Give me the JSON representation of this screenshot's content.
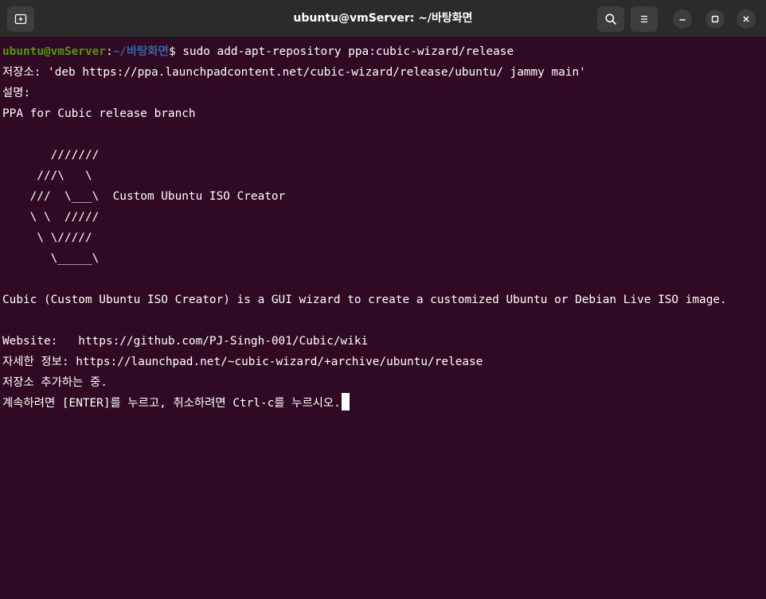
{
  "window": {
    "title": "ubuntu@vmServer: ~/바탕화면"
  },
  "titlebar": {
    "new_tab_icon": "new-tab-icon",
    "search_icon": "search-icon",
    "menu_icon": "hamburger-menu-icon",
    "minimize_icon": "minimize-icon",
    "maximize_icon": "maximize-icon",
    "close_icon": "close-icon"
  },
  "colors": {
    "terminal_bg": "#300a24",
    "titlebar_bg": "#2b2b2b",
    "prompt_user": "#4e9a06",
    "prompt_path": "#3465a4",
    "text": "#ffffff"
  },
  "terminal": {
    "prompt": {
      "user_host": "ubuntu@vmServer",
      "colon": ":",
      "path": "~/바탕화면",
      "dollar": "$ ",
      "command": "sudo add-apt-repository ppa:cubic-wizard/release"
    },
    "lines": [
      "저장소: 'deb https://ppa.launchpadcontent.net/cubic-wizard/release/ubuntu/ jammy main'",
      "설명:",
      "PPA for Cubic release branch",
      "",
      "       ///////",
      "     ///\\   \\",
      "    ///  \\___\\  Custom Ubuntu ISO Creator",
      "    \\ \\  /////",
      "     \\ \\/////",
      "       \\_____\\",
      "",
      "Cubic (Custom Ubuntu ISO Creator) is a GUI wizard to create a customized Ubuntu or Debian Live ISO image.",
      "",
      "Website:   https://github.com/PJ-Singh-001/Cubic/wiki",
      "자세한 정보: https://launchpad.net/~cubic-wizard/+archive/ubuntu/release",
      "저장소 추가하는 중.",
      "계속하려면 [ENTER]를 누르고, 취소하려면 Ctrl-c를 누르시오."
    ]
  }
}
